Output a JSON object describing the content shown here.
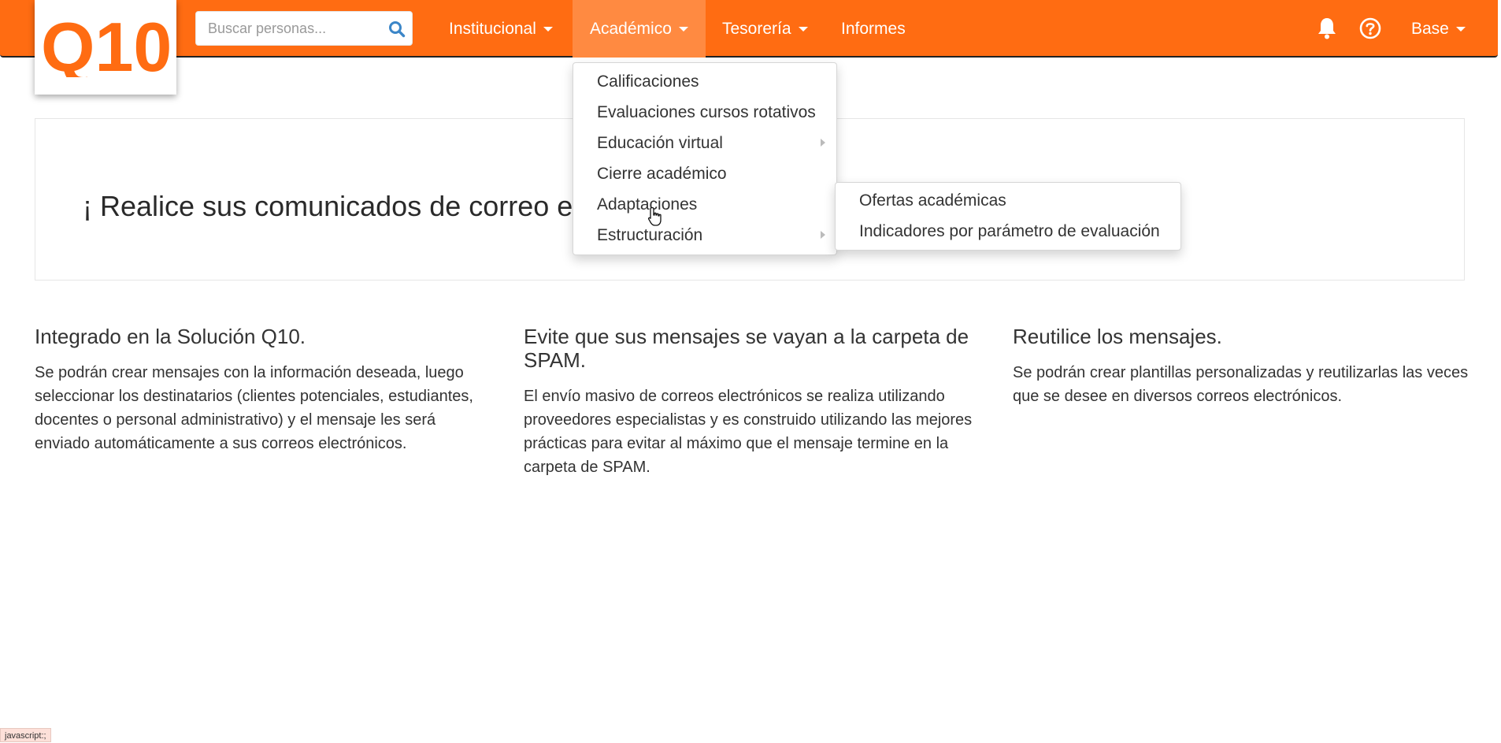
{
  "colors": {
    "brand": "#ff6c12",
    "brand_active": "#ff8a41",
    "search_icon": "#3b86c8"
  },
  "logo": {
    "text": "Q10",
    "color": "#ff6c12"
  },
  "search": {
    "placeholder": "Buscar personas..."
  },
  "nav": {
    "items": [
      {
        "label": "Institucional",
        "has_caret": true
      },
      {
        "label": "Académico",
        "has_caret": true,
        "active": true
      },
      {
        "label": "Tesorería",
        "has_caret": true
      },
      {
        "label": "Informes",
        "has_caret": false
      }
    ],
    "icons": [
      "bell-icon",
      "help-circle-icon"
    ],
    "user_menu": "Base"
  },
  "academic_menu": {
    "items": [
      {
        "label": "Calificaciones",
        "has_submenu": false
      },
      {
        "label": "Evaluaciones cursos rotativos",
        "has_submenu": false
      },
      {
        "label": "Educación virtual",
        "has_submenu": true
      },
      {
        "label": "Cierre académico",
        "has_submenu": false
      },
      {
        "label": "Adaptaciones",
        "has_submenu": false,
        "hovered": true
      },
      {
        "label": "Estructuración",
        "has_submenu": true
      }
    ]
  },
  "adaptaciones_submenu": {
    "items": [
      {
        "label": "Ofertas académicas"
      },
      {
        "label": "Indicadores por parámetro de evaluación"
      }
    ]
  },
  "hero": {
    "text": "¡ Realice sus comunicados de correo ele"
  },
  "features": [
    {
      "title": "Integrado en la Solución Q10.",
      "body": "Se podrán crear mensajes con la información deseada, luego seleccionar los destinatarios (clientes potenciales, estudiantes, docentes o personal administrativo) y el mensaje les será enviado automáticamente a sus correos electrónicos."
    },
    {
      "title": "Evite que sus mensajes se vayan a la carpeta de SPAM.",
      "body": "El envío masivo de correos electrónicos se realiza utilizando proveedores especialistas y es construido utilizando las mejores prácticas para evitar al máximo que el mensaje termine en la carpeta de SPAM."
    },
    {
      "title": "Reutilice los mensajes.",
      "body": "Se podrán crear plantillas personalizadas y reutilizarlas las veces que se desee en diversos correos electrónicos."
    }
  ],
  "statusbar": {
    "text": "javascript:;"
  }
}
